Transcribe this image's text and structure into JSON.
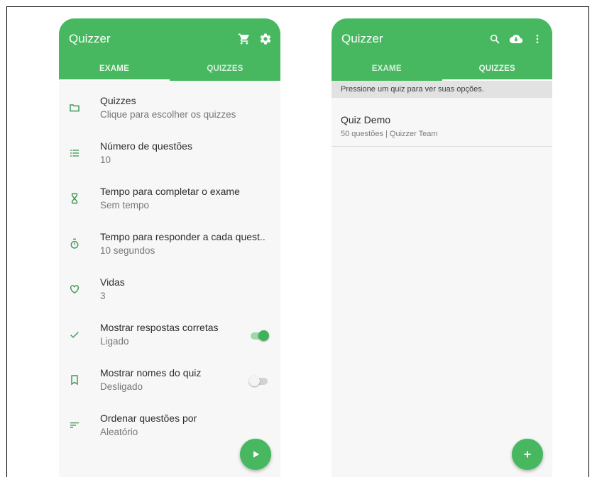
{
  "colors": {
    "accent": "#47b860",
    "toggle_on": "#3eb35a",
    "background": "#f7f7f7"
  },
  "exam_screen": {
    "title": "Quizzer",
    "actions": [
      "cart-icon",
      "gear-icon"
    ],
    "tabs": [
      {
        "label": "EXAME",
        "active": true
      },
      {
        "label": "QUIZZES",
        "active": false
      }
    ],
    "settings": [
      {
        "icon": "folder-icon",
        "title": "Quizzes",
        "subtitle": "Clique para escolher os quizzes"
      },
      {
        "icon": "list-icon",
        "title": "Número de questões",
        "subtitle": "10"
      },
      {
        "icon": "hourglass-icon",
        "title": "Tempo para completar o exame",
        "subtitle": "Sem tempo"
      },
      {
        "icon": "stopwatch-icon",
        "title": "Tempo para responder a cada quest..",
        "subtitle": "10 segundos"
      },
      {
        "icon": "heart-icon",
        "title": "Vidas",
        "subtitle": "3"
      },
      {
        "icon": "check-icon",
        "title": "Mostrar respostas corretas",
        "subtitle": "Ligado",
        "toggle": true
      },
      {
        "icon": "bookmark-icon",
        "title": "Mostrar nomes do quiz",
        "subtitle": "Desligado",
        "toggle": false
      },
      {
        "icon": "sort-icon",
        "title": "Ordenar questões por",
        "subtitle": "Aleatório"
      }
    ],
    "fab": "play-icon"
  },
  "quizzes_screen": {
    "title": "Quizzer",
    "actions": [
      "search-icon",
      "cloud-download-icon",
      "more-vert-icon"
    ],
    "tabs": [
      {
        "label": "EXAME",
        "active": false
      },
      {
        "label": "QUIZZES",
        "active": true
      }
    ],
    "hint": "Pressione um quiz para ver suas opções.",
    "quizzes": [
      {
        "name": "Quiz Demo",
        "meta": "50 questões | Quizzer Team"
      }
    ],
    "fab": "add-icon"
  }
}
